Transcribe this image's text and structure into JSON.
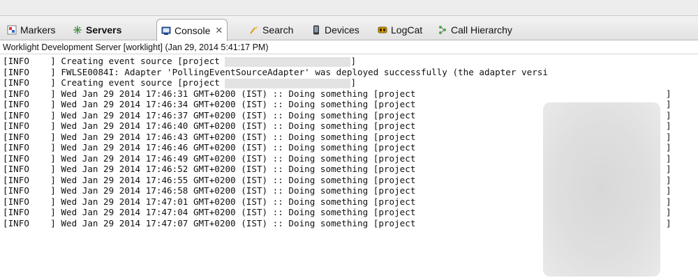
{
  "tabs": [
    {
      "label": "Markers",
      "icon": "markers-icon",
      "bold": false,
      "active": false
    },
    {
      "label": "Servers",
      "icon": "servers-icon",
      "bold": true,
      "active": false
    },
    {
      "label": "Console",
      "icon": "console-icon",
      "bold": false,
      "active": true,
      "close": "✕"
    },
    {
      "label": "Search",
      "icon": "search-icon",
      "bold": false,
      "active": false
    },
    {
      "label": "Devices",
      "icon": "devices-icon",
      "bold": false,
      "active": false
    },
    {
      "label": "LogCat",
      "icon": "logcat-icon",
      "bold": false,
      "active": false
    },
    {
      "label": "Call Hierarchy",
      "icon": "call-hierarchy-icon",
      "bold": false,
      "active": false
    }
  ],
  "console": {
    "title": "Worklight Development Server [worklight] (Jan 29, 2014 5:41:17 PM)",
    "lines": [
      "[INFO    ] Creating event source [project ",
      "[INFO    ] FWLSE0084I: Adapter 'PollingEventSourceAdapter' was deployed successfully (the adapter versi",
      "[INFO    ] Creating event source [project ",
      "[INFO    ] Wed Jan 29 2014 17:46:31 GMT+0200 (IST) :: Doing something [project ",
      "[INFO    ] Wed Jan 29 2014 17:46:34 GMT+0200 (IST) :: Doing something [project ",
      "[INFO    ] Wed Jan 29 2014 17:46:37 GMT+0200 (IST) :: Doing something [project ",
      "[INFO    ] Wed Jan 29 2014 17:46:40 GMT+0200 (IST) :: Doing something [project ",
      "[INFO    ] Wed Jan 29 2014 17:46:43 GMT+0200 (IST) :: Doing something [project ",
      "[INFO    ] Wed Jan 29 2014 17:46:46 GMT+0200 (IST) :: Doing something [project ",
      "[INFO    ] Wed Jan 29 2014 17:46:49 GMT+0200 (IST) :: Doing something [project ",
      "[INFO    ] Wed Jan 29 2014 17:46:52 GMT+0200 (IST) :: Doing something [project ",
      "[INFO    ] Wed Jan 29 2014 17:46:55 GMT+0200 (IST) :: Doing something [project ",
      "[INFO    ] Wed Jan 29 2014 17:46:58 GMT+0200 (IST) :: Doing something [project ",
      "[INFO    ] Wed Jan 29 2014 17:47:01 GMT+0200 (IST) :: Doing something [project ",
      "[INFO    ] Wed Jan 29 2014 17:47:04 GMT+0200 (IST) :: Doing something [project ",
      "[INFO    ] Wed Jan 29 2014 17:47:07 GMT+0200 (IST) :: Doing something [project "
    ],
    "closing_bracket": "]"
  }
}
